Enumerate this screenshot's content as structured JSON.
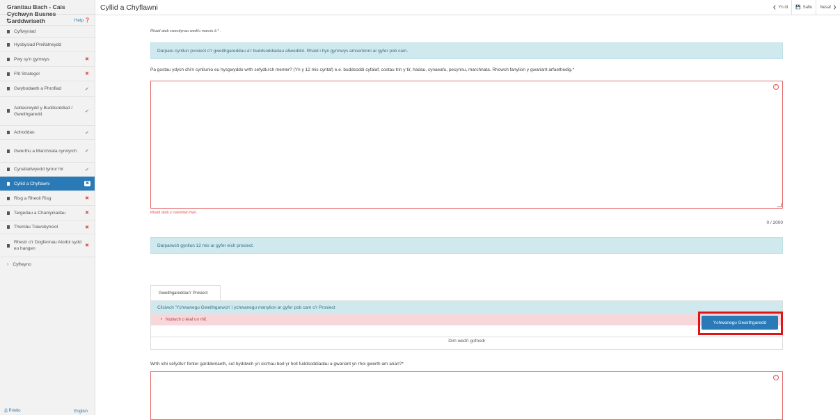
{
  "app": {
    "title": "Grantiau Bach - Cais Cychwyn Busnes Garddwriaeth"
  },
  "userbar": {
    "help_label": "Help"
  },
  "sidebar": {
    "items": [
      {
        "label": "Cyflwyniad",
        "status": ""
      },
      {
        "label": "Hysbysiad Preifatrwydd",
        "status": ""
      },
      {
        "label": "Pwy sy'n gymwys",
        "status": "✖"
      },
      {
        "label": "Ffit Strategol",
        "status": "✖"
      },
      {
        "label": "Gwybodaeth a Phrofiad",
        "status": "✔"
      },
      {
        "label": "Addasrwydd y Buddsoddiad / Gweithgaredd",
        "status": "✔"
      },
      {
        "label": "Adnoddau",
        "status": "✔"
      },
      {
        "label": "Gwerthu a Marchnata cynnyrch",
        "status": "✔"
      },
      {
        "label": "Cynaliadwyedd tymor hir",
        "status": "✔"
      },
      {
        "label": "Cyllid a Chyflawni",
        "status": "✖"
      },
      {
        "label": "Risg a Rheoli Risg",
        "status": "✖"
      },
      {
        "label": "Targedau a Chanlyniadau",
        "status": "✖"
      },
      {
        "label": "Themâu Trawsbynciol",
        "status": "✖"
      },
      {
        "label": "Rhestr o'r Dogfennau Atodol sydd eu hangen",
        "status": "✖"
      }
    ],
    "submit_label": "Cyflwyno",
    "print_label": "Printio",
    "language_label": "English"
  },
  "header": {
    "page_title": "Cyllid a Chyflawni",
    "back_label": "Yn ôl",
    "save_label": "Safio",
    "next_label": "Nesaf"
  },
  "main": {
    "required_note": "Rhaid ateb cwestiynau wedi'u marcio â * .",
    "info1": "Darparu cynllun prosiect o'r gweithgareddau a'r buddsoddiadau allweddol. Rhaid i hyn gynnwys amserlenni ar gyfer pob cam.",
    "question1": "Pa gostau ydych chi'n cynllunio eu hysgwyddo wrth sefydlu'ch menter? (Yn y 12 mis cyntaf) e.e. buddsoddi cyfalaf, costau trin y tir, hadau, cynaeafu, pecynnu, marchnata. Rhowch fanylion y gwariant arfaethedig.*",
    "error1": "Rhaid ateb y cwestiwn hwn.",
    "counter1": "0 / 2000",
    "info2": "Darparwch gynllun 12 mis ar gyfer eich prosiect.",
    "tab_label": "Gweithgareddau'r Prosiect",
    "info3": "Cliciwch 'Ychwanegu Gweithgarwch' i ychwanegu manylion ar gyfer pob cam o'r Prosiect",
    "error_item": "Nodwch o leiaf un rhif.",
    "add_button": "Ychwanegu Gweithgaredd",
    "no_data": "Dim wedi'i gofnodi",
    "question2": "Wrth ichi sefydlu'r fenter garddwriaeth, sut byddwch yn sicrhau bod yr holl fuddsoddiadau a gwariant yn rhoi gwerth am arian?*"
  }
}
